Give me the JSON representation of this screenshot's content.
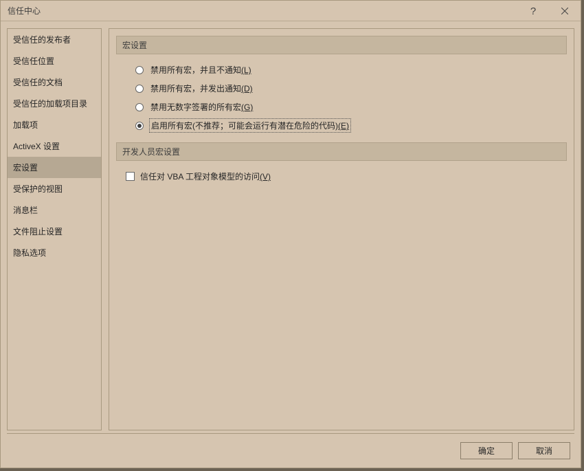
{
  "title": "信任中心",
  "sidebar": {
    "items": [
      {
        "label": "受信任的发布者",
        "selected": false
      },
      {
        "label": "受信任位置",
        "selected": false
      },
      {
        "label": "受信任的文档",
        "selected": false
      },
      {
        "label": "受信任的加载项目录",
        "selected": false
      },
      {
        "label": "加载项",
        "selected": false
      },
      {
        "label": "ActiveX 设置",
        "selected": false
      },
      {
        "label": "宏设置",
        "selected": true
      },
      {
        "label": "受保护的视图",
        "selected": false
      },
      {
        "label": "消息栏",
        "selected": false
      },
      {
        "label": "文件阻止设置",
        "selected": false
      },
      {
        "label": "隐私选项",
        "selected": false
      }
    ]
  },
  "sections": {
    "macro": {
      "header": "宏设置",
      "options": [
        {
          "text": "禁用所有宏，并且不通知",
          "accel": "(L)",
          "checked": false
        },
        {
          "text": "禁用所有宏，并发出通知",
          "accel": "(D)",
          "checked": false
        },
        {
          "text": "禁用无数字签署的所有宏",
          "accel": "(G)",
          "checked": false
        },
        {
          "text": "启用所有宏(不推荐；可能会运行有潜在危险的代码)",
          "accel": "(E)",
          "checked": true,
          "focused": true
        }
      ]
    },
    "developer": {
      "header": "开发人员宏设置",
      "checkbox": {
        "text": "信任对 VBA 工程对象模型的访问",
        "accel": "(V)",
        "checked": false
      }
    }
  },
  "footer": {
    "ok": "确定",
    "cancel": "取消"
  }
}
